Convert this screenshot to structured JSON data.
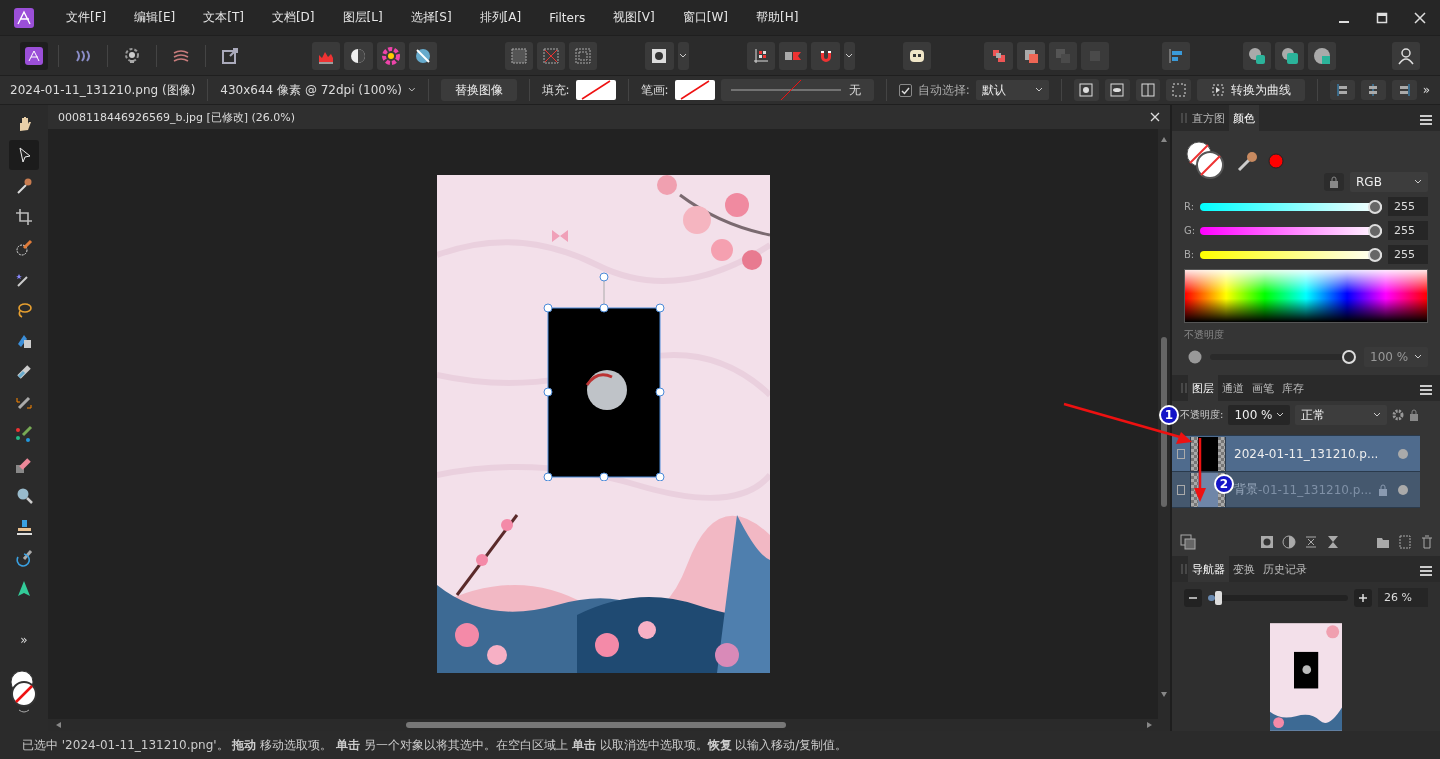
{
  "menu": [
    {
      "label": "文件[F]"
    },
    {
      "label": "编辑[E]"
    },
    {
      "label": "文本[T]"
    },
    {
      "label": "文档[D]"
    },
    {
      "label": "图层[L]"
    },
    {
      "label": "选择[S]"
    },
    {
      "label": "排列[A]"
    },
    {
      "label": "Filters"
    },
    {
      "label": "视图[V]"
    },
    {
      "label": "窗口[W]"
    },
    {
      "label": "帮助[H]"
    }
  ],
  "personas": [
    {
      "selected": true
    },
    {
      "selected": false
    },
    {
      "selected": false
    },
    {
      "selected": false
    },
    {
      "selected": false
    }
  ],
  "context_bar": {
    "layer_name": "2024-01-11_131210.png (图像)",
    "dimensions": "430x644 像素 @ 72dpi (100%)",
    "replace_button": "替换图像",
    "fill_label": "填充:",
    "stroke_label": "笔画:",
    "stroke_width": "无",
    "auto_select": {
      "label": "自动选择:",
      "checked": true
    },
    "auto_select_value": "默认",
    "convert_button": "转换为曲线",
    "more": "»"
  },
  "tools": [
    {
      "selected": false
    },
    {
      "selected": true
    },
    {
      "selected": false
    },
    {
      "selected": false
    },
    {
      "selected": false
    },
    {
      "selected": false
    },
    {
      "selected": false
    },
    {
      "selected": false
    },
    {
      "selected": false
    },
    {
      "selected": false
    },
    {
      "selected": false
    },
    {
      "selected": false
    },
    {
      "selected": false
    },
    {
      "selected": false
    },
    {
      "selected": false
    },
    {
      "selected": false
    }
  ],
  "tools_more": "»",
  "document": {
    "tab_title": "0008118446926569_b.jpg [已修改] (26.0%)"
  },
  "color_panel": {
    "tabs": [
      {
        "label": "直方图",
        "selected": false
      },
      {
        "label": "颜色",
        "selected": true
      }
    ],
    "mode": "RGB",
    "channels": [
      {
        "label": "R:",
        "level": 1,
        "reading": "255"
      },
      {
        "label": "G:",
        "level": 1,
        "reading": "255"
      },
      {
        "label": "B:",
        "level": 1,
        "reading": "255"
      }
    ],
    "opacity_label": "不透明度",
    "opacity": {
      "level": 1,
      "reading": "100 %"
    }
  },
  "layers_panel": {
    "tabs": [
      {
        "label": "图层",
        "selected": true
      },
      {
        "label": "通道",
        "selected": false
      },
      {
        "label": "画笔",
        "selected": false
      },
      {
        "label": "库存",
        "selected": false
      }
    ],
    "opacity_label": "不透明度:",
    "opacity_value": "100 %",
    "blend_mode": "正常",
    "layers": [
      {
        "name": "2024-01-11_131210.p...",
        "selected": true,
        "dragged": false,
        "locked": false
      },
      {
        "name": "背景",
        "ghost_text": "-01-11_131210.p...",
        "selected": false,
        "dragged": true,
        "locked": true
      }
    ]
  },
  "navigator_panel": {
    "tabs": [
      {
        "label": "导航器",
        "selected": true
      },
      {
        "label": "变换",
        "selected": false
      },
      {
        "label": "历史记录",
        "selected": false
      }
    ],
    "zoom": {
      "level": 0.05,
      "reading": "26 %"
    }
  },
  "annotations": [
    {
      "label": "1"
    },
    {
      "label": "2"
    }
  ],
  "status_bar": "已选中 '2024-01-11_131210.png'。 **拖动** 移动选取项。 **单击** 另一个对象以将其选中。在空白区域上 **单击** 以取消选中选取项。**恢复** 以输入移动/复制值。"
}
